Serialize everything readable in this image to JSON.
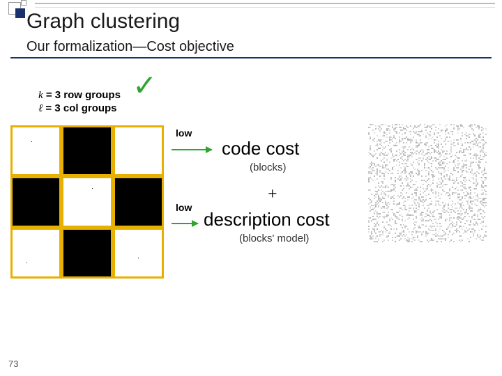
{
  "header": {
    "title": "Graph clustering",
    "subtitle": "Our formalization—Cost objective"
  },
  "groups": {
    "k_var": "k",
    "k_eq": " = 3 row groups",
    "l_var": "ℓ",
    "l_eq": " = 3 col groups"
  },
  "checkmark": "✓",
  "grid": {
    "black_cells": [
      [
        0,
        1
      ],
      [
        1,
        0
      ],
      [
        1,
        2
      ],
      [
        2,
        1
      ]
    ]
  },
  "labels": {
    "low1": "low",
    "low2": "low",
    "code_cost": "code cost",
    "code_sub": "(blocks)",
    "plus": "+",
    "desc_cost": "description cost",
    "desc_sub": "(blocks' model)"
  },
  "page": "73",
  "colors": {
    "accent": "#19326e",
    "gridborder": "#e8b000",
    "arrow": "#2fa52f"
  }
}
